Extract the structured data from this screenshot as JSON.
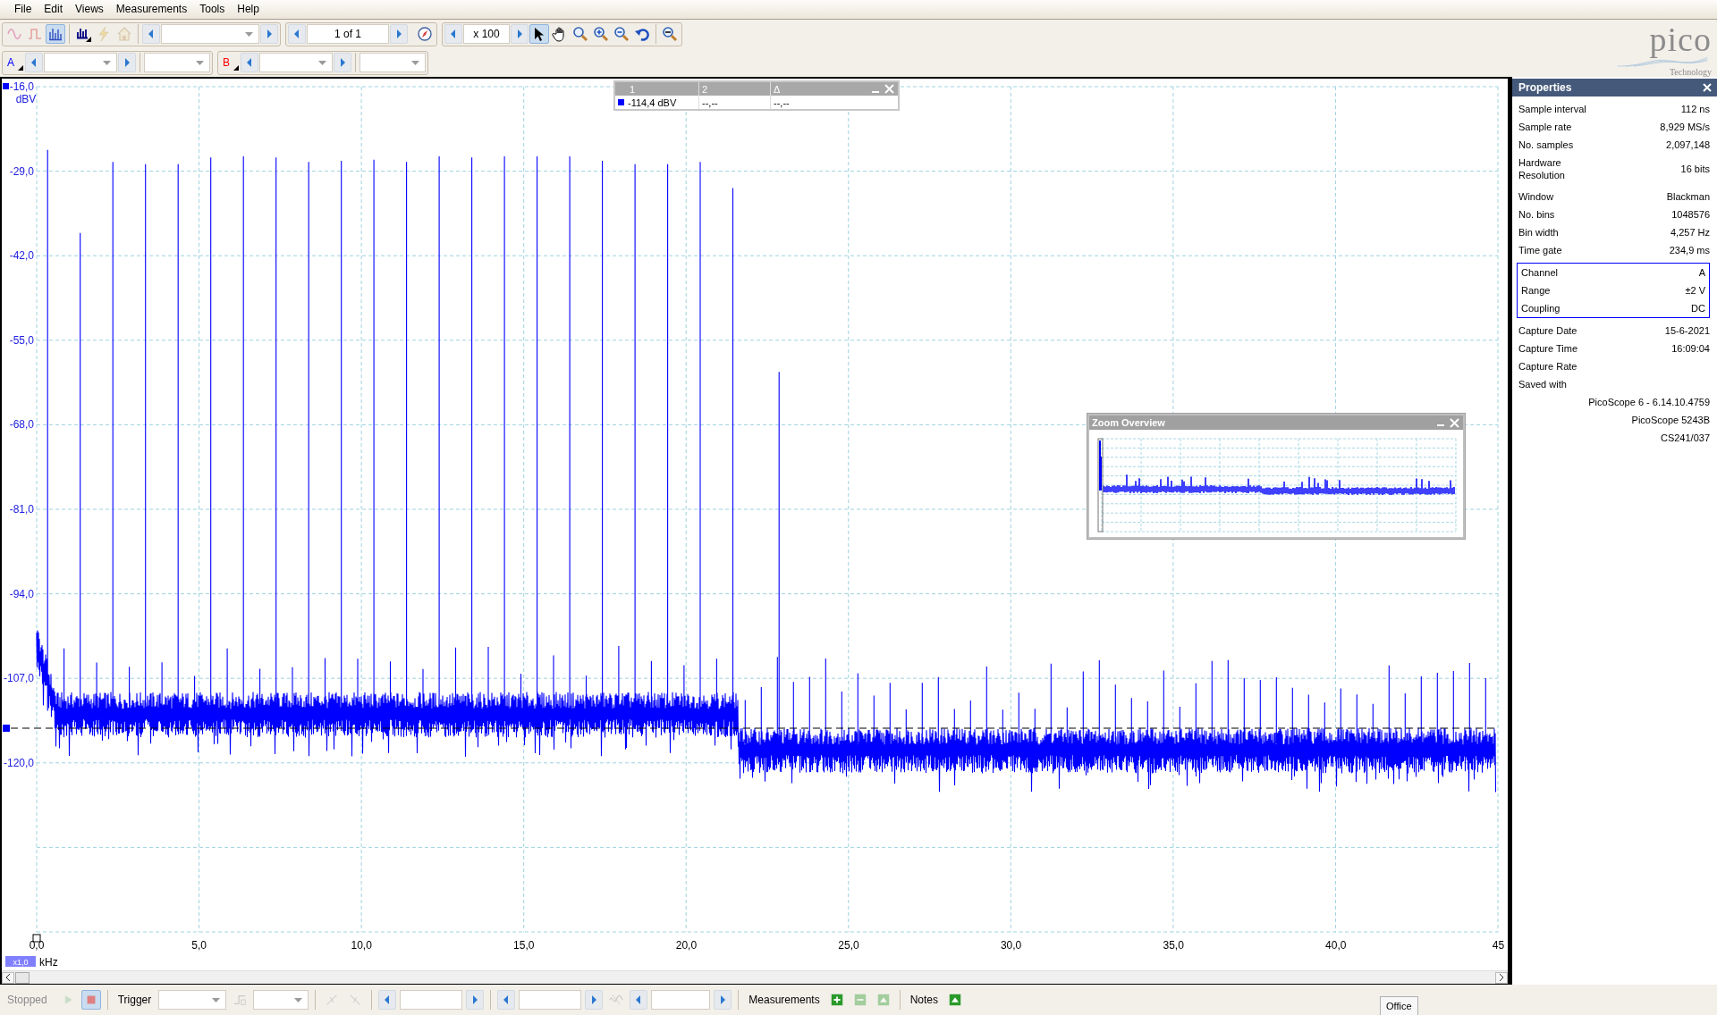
{
  "menu": [
    {
      "label": "File"
    },
    {
      "label": "Edit"
    },
    {
      "label": "Views"
    },
    {
      "label": "Measurements"
    },
    {
      "label": "Tools"
    },
    {
      "label": "Help"
    }
  ],
  "toolbar": {
    "view_buttons": [
      {
        "kind": "scope",
        "selected": false,
        "disabled": true
      },
      {
        "kind": "persistence",
        "selected": false,
        "disabled": true
      },
      {
        "kind": "spectrum",
        "selected": true,
        "disabled": false
      }
    ],
    "action_buttons": [
      {
        "kind": "spectrum-options",
        "disabled": false
      },
      {
        "kind": "auto-setup",
        "disabled": true
      },
      {
        "kind": "default-setup",
        "disabled": true
      }
    ],
    "buffer": {
      "value": "1 of 1"
    },
    "zoom": {
      "value": "x 100"
    },
    "tools": [
      {
        "kind": "pointer",
        "selected": true
      },
      {
        "kind": "hand",
        "selected": false
      },
      {
        "kind": "zoom-box",
        "selected": false
      },
      {
        "kind": "zoom-in",
        "selected": false
      },
      {
        "kind": "zoom-out",
        "selected": false
      },
      {
        "kind": "undo",
        "selected": false
      }
    ],
    "channels": [
      {
        "label": "A",
        "color": "#0000ff"
      },
      {
        "label": "B",
        "color": "#ff0000"
      }
    ]
  },
  "logo": {
    "name": "pico",
    "tagline": "Technology"
  },
  "scope": {
    "y_unit": "dBV",
    "y_ticks": [
      "-16,0",
      "-29,0",
      "-42,0",
      "-55,0",
      "-68,0",
      "-81,0",
      "-94,0",
      "-107,0",
      "-120,0"
    ],
    "x_ticks": [
      "0,0",
      "5,0",
      "10,0",
      "15,0",
      "20,0",
      "25,0",
      "30,0",
      "35,0",
      "40,0",
      "45"
    ],
    "x_scale": "x1,0",
    "x_unit": "kHz",
    "cursor_table": {
      "columns": [
        "1",
        "2",
        "Δ"
      ],
      "row": {
        "color": "#0000ff",
        "values": [
          "-114,4 dBV",
          "--,--",
          "--,--"
        ]
      }
    },
    "zoom_overview": {
      "title": "Zoom Overview"
    }
  },
  "properties": {
    "title": "Properties",
    "rows": [
      {
        "label": "Sample interval",
        "value": "112 ns"
      },
      {
        "label": "Sample rate",
        "value": "8,929 MS/s"
      },
      {
        "label": "No. samples",
        "value": "2,097,148"
      },
      {
        "label": "Hardware Resolution",
        "value": "16 bits"
      },
      {
        "label": "Window",
        "value": "Blackman"
      },
      {
        "label": "No. bins",
        "value": "1048576"
      },
      {
        "label": "Bin width",
        "value": "4,257 Hz"
      },
      {
        "label": "Time gate",
        "value": "234,9 ms"
      }
    ],
    "channel": [
      {
        "label": "Channel",
        "value": "A"
      },
      {
        "label": "Range",
        "value": "±2 V"
      },
      {
        "label": "Coupling",
        "value": "DC"
      }
    ],
    "capture": [
      {
        "label": "Capture Date",
        "value": "15-6-2021"
      },
      {
        "label": "Capture Time",
        "value": "16:09:04"
      },
      {
        "label": "Capture Rate"
      },
      {
        "label": "Saved with"
      }
    ],
    "saved_with": [
      "PicoScope 6 - 6.14.10.4759",
      "PicoScope 5243B",
      "CS241/037"
    ]
  },
  "status_bar": {
    "state": "Stopped",
    "running": false,
    "trigger_label": "Trigger",
    "measurements_label": "Measurements",
    "notes_label": "Notes",
    "measurement_buttons": [
      {
        "kind": "add",
        "disabled": false
      },
      {
        "kind": "delete",
        "disabled": true
      },
      {
        "kind": "edit",
        "disabled": true
      }
    ]
  },
  "taskbar_tab": {
    "label": "Office"
  }
}
